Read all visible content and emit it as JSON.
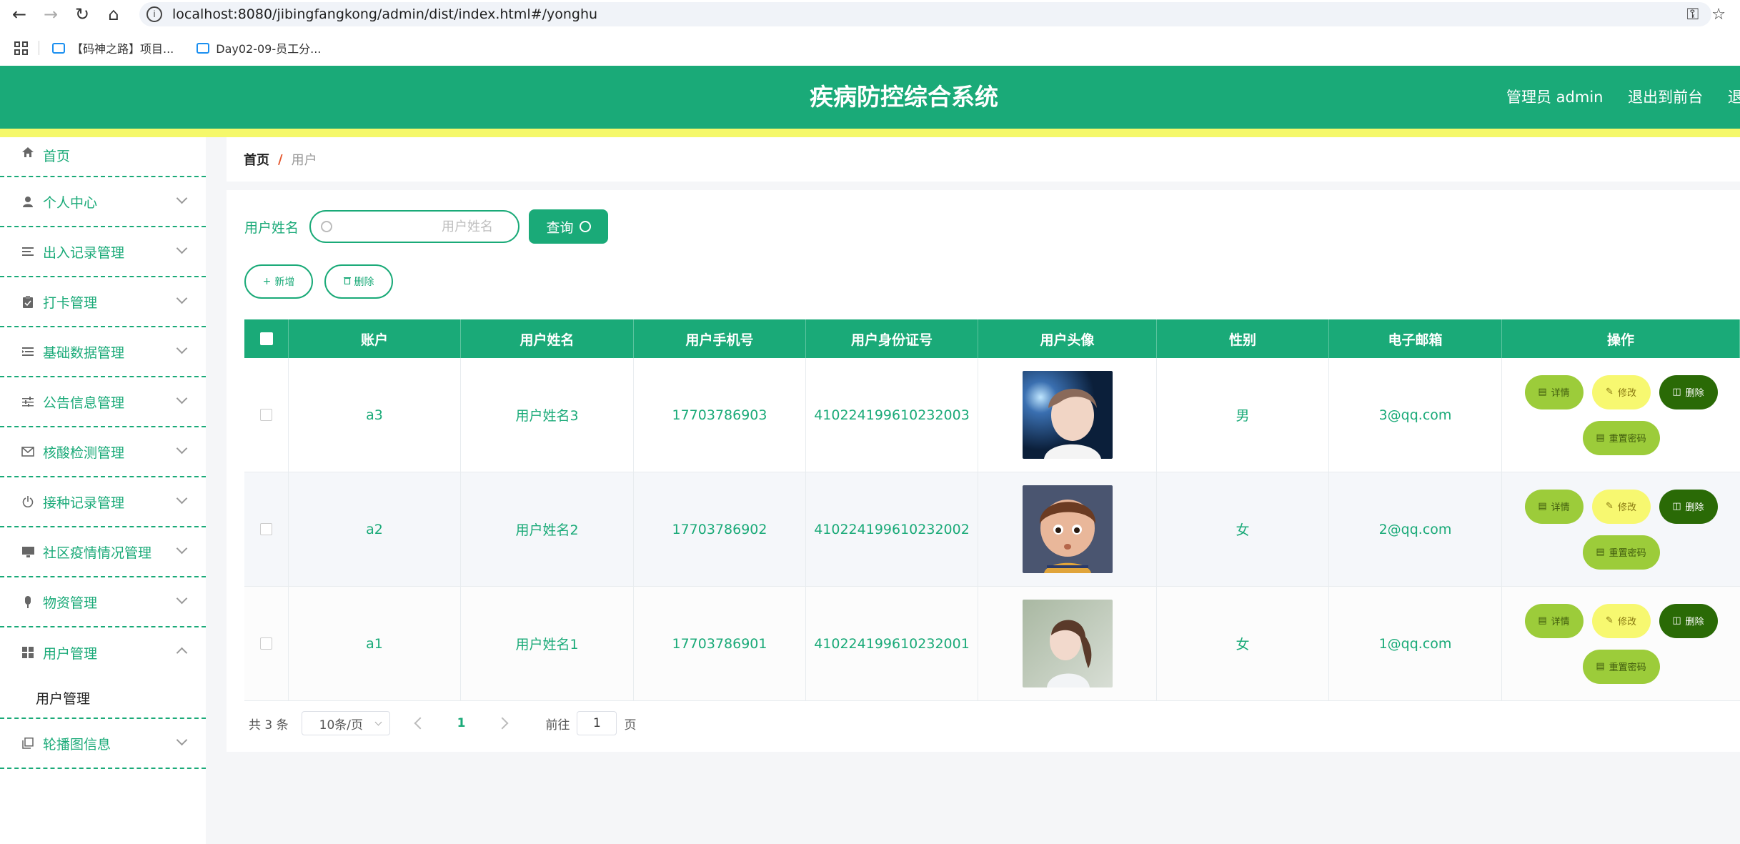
{
  "browser": {
    "url": "localhost:8080/jibingfangkong/admin/dist/index.html#/yonghu",
    "bookmarks": [
      "【码神之路】项目...",
      "Day02-09-员工分..."
    ]
  },
  "header": {
    "title": "疾病防控综合系统",
    "user": "管理员 admin",
    "to_front": "退出到前台",
    "logout": "退出"
  },
  "sidebar": {
    "items": [
      {
        "label": "首页",
        "icon": "home-icon"
      },
      {
        "label": "个人中心",
        "icon": "user-icon"
      },
      {
        "label": "出入记录管理",
        "icon": "list-icon"
      },
      {
        "label": "打卡管理",
        "icon": "clipboard-icon"
      },
      {
        "label": "基础数据管理",
        "icon": "list-indent-icon"
      },
      {
        "label": "公告信息管理",
        "icon": "sliders-icon"
      },
      {
        "label": "核酸检测管理",
        "icon": "mail-icon"
      },
      {
        "label": "接种记录管理",
        "icon": "power-icon"
      },
      {
        "label": "社区疫情情况管理",
        "icon": "monitor-icon"
      },
      {
        "label": "物资管理",
        "icon": "microphone-icon"
      },
      {
        "label": "用户管理",
        "icon": "grid-icon",
        "sub": "用户管理"
      },
      {
        "label": "轮播图信息",
        "icon": "copy-icon"
      }
    ]
  },
  "breadcrumb": {
    "home": "首页",
    "separator": "/",
    "current": "用户"
  },
  "search": {
    "label": "用户姓名",
    "placeholder": "用户姓名",
    "button": "查询"
  },
  "actions": {
    "add": "新增",
    "delete": "删除"
  },
  "table": {
    "headers": [
      "账户",
      "用户姓名",
      "用户手机号",
      "用户身份证号",
      "用户头像",
      "性别",
      "电子邮箱",
      "操作"
    ],
    "rows": [
      {
        "account": "a3",
        "name": "用户姓名3",
        "phone": "17703786903",
        "idcard": "410224199610232003",
        "gender": "男",
        "email": "3@qq.com"
      },
      {
        "account": "a2",
        "name": "用户姓名2",
        "phone": "17703786902",
        "idcard": "410224199610232002",
        "gender": "女",
        "email": "2@qq.com"
      },
      {
        "account": "a1",
        "name": "用户姓名1",
        "phone": "17703786901",
        "idcard": "410224199610232001",
        "gender": "女",
        "email": "1@qq.com"
      }
    ],
    "ops": {
      "detail": "详情",
      "edit": "修改",
      "del": "删除",
      "reset": "重置密码"
    }
  },
  "pager": {
    "total": "共 3 条",
    "size": "10条/页",
    "page": "1",
    "goto": "前往",
    "goto_value": "1",
    "page_unit": "页"
  },
  "colors": {
    "primary": "#1aaa78",
    "yellow": "#f5f86a",
    "lime": "#9ccc3a",
    "dark": "#2a6a06"
  }
}
